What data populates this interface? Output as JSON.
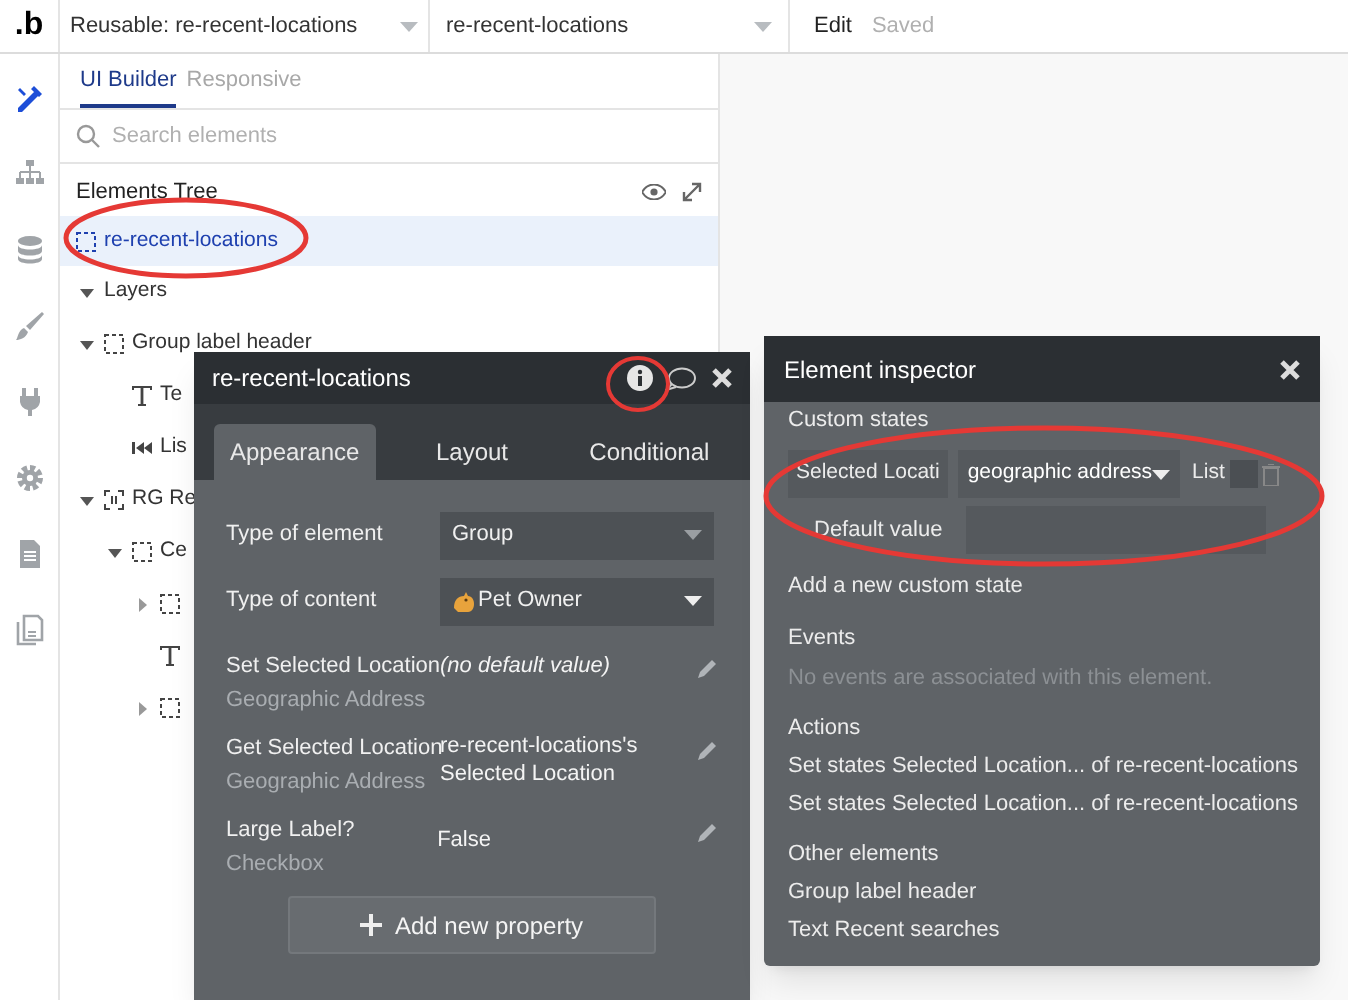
{
  "top_bar": {
    "logo": ".b",
    "page_dropdown": "Reusable: re-recent-locations",
    "element_dropdown": "re-recent-locations",
    "edit": "Edit",
    "status": "Saved"
  },
  "rail": [
    {
      "kind": "design",
      "selected": true
    },
    {
      "kind": "workflow",
      "selected": false
    },
    {
      "kind": "data",
      "selected": false
    },
    {
      "kind": "styles",
      "selected": false
    },
    {
      "kind": "plugins",
      "selected": false
    },
    {
      "kind": "settings",
      "selected": false
    },
    {
      "kind": "logs",
      "selected": false
    },
    {
      "kind": "pages",
      "selected": false
    }
  ],
  "sidebar": {
    "tabs": [
      {
        "label": "UI Builder",
        "selected": true
      },
      {
        "label": "Responsive",
        "selected": false
      }
    ],
    "search": {
      "placeholder": "Search elements"
    },
    "tree_title": "Elements Tree",
    "tree": [
      {
        "label": "re-recent-locations",
        "kind": "group",
        "selected": true
      },
      {
        "label": "Layers",
        "kind": "section",
        "selected": false,
        "expanded": true,
        "children": [
          {
            "label": "Group label header",
            "kind": "group",
            "selected": false,
            "expanded": true,
            "children": [
              {
                "label": "Te",
                "kind": "text",
                "selected": false
              },
              {
                "label": "Lis",
                "kind": "list",
                "selected": false
              }
            ]
          },
          {
            "label": "RG Re",
            "kind": "repeating",
            "selected": false,
            "expanded": true,
            "children": [
              {
                "label": "Ce",
                "kind": "group",
                "selected": false,
                "expanded": true,
                "children": [
                  {
                    "kind": "group",
                    "selected": false,
                    "expanded": false
                  },
                  {
                    "kind": "text",
                    "selected": false
                  },
                  {
                    "kind": "group",
                    "selected": false,
                    "expanded": false
                  }
                ]
              }
            ]
          }
        ]
      }
    ]
  },
  "property_editor": {
    "title": "re-recent-locations",
    "tabs": [
      {
        "label": "Appearance",
        "selected": true
      },
      {
        "label": "Layout",
        "selected": false
      },
      {
        "label": "Conditional",
        "selected": false
      }
    ],
    "fields": [
      {
        "label": "Type of element",
        "value": "Group",
        "disabled": true
      },
      {
        "label": "Type of content",
        "value": "Pet Owner",
        "disabled": false,
        "kind": "type"
      }
    ],
    "properties": [
      {
        "name": "Set Selected Location",
        "type": "Geographic Address",
        "value": "(no default value)",
        "kind": "empty"
      },
      {
        "name": "Get Selected Location",
        "type": "Geographic Address",
        "value": "re-recent-locations's Selected Location",
        "kind": "value"
      },
      {
        "name": "Large Label?",
        "type": "Checkbox",
        "value": "False",
        "kind": "value"
      }
    ],
    "add_button": "Add new property"
  },
  "inspector": {
    "title": "Element inspector",
    "custom_states_heading": "Custom states",
    "custom_state": {
      "name": "Selected Locati",
      "type": "geographic address",
      "list_label": "List",
      "list": false,
      "default_label": "Default value"
    },
    "add_state": "Add a new custom state",
    "events_heading": "Events",
    "events_empty": "No events are associated with this element.",
    "actions_heading": "Actions",
    "actions": [
      "Set states Selected Location... of re-recent-locations",
      "Set states Selected Location... of re-recent-locations"
    ],
    "other_heading": "Other elements",
    "other_elements": [
      "Group label header",
      "Text Recent searches"
    ]
  }
}
